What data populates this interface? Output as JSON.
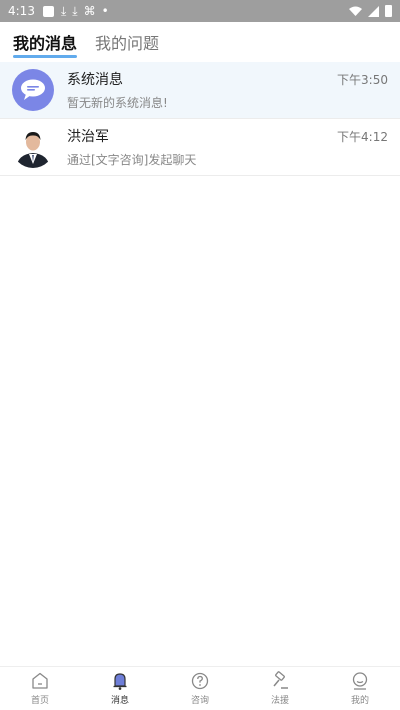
{
  "status_bar": {
    "time": "4:13",
    "icons": [
      "notification-square-icon",
      "download-icon",
      "download-icon",
      "app-icon",
      "dot-icon",
      "wifi-icon",
      "signal-icon",
      "battery-icon"
    ]
  },
  "tabs": [
    {
      "label": "我的消息",
      "active": true
    },
    {
      "label": "我的问题",
      "active": false
    }
  ],
  "messages": [
    {
      "title": "系统消息",
      "time": "下午3:50",
      "preview": "暂无新的系统消息!",
      "avatar": "chat-bubble-icon"
    },
    {
      "title": "洪治军",
      "time": "下午4:12",
      "preview": "通过[文字咨询]发起聊天",
      "avatar": "user-photo"
    }
  ],
  "bottom_nav": [
    {
      "label": "首页",
      "icon": "home-icon"
    },
    {
      "label": "消息",
      "icon": "bell-icon",
      "active": true
    },
    {
      "label": "咨询",
      "icon": "question-icon"
    },
    {
      "label": "法援",
      "icon": "gavel-icon"
    },
    {
      "label": "我的",
      "icon": "profile-icon"
    }
  ],
  "colors": {
    "status_bar": "#9e9e9e",
    "accent": "#1e88e5",
    "system_avatar": "#7b86e6",
    "highlight_row": "#f1f7fc"
  }
}
